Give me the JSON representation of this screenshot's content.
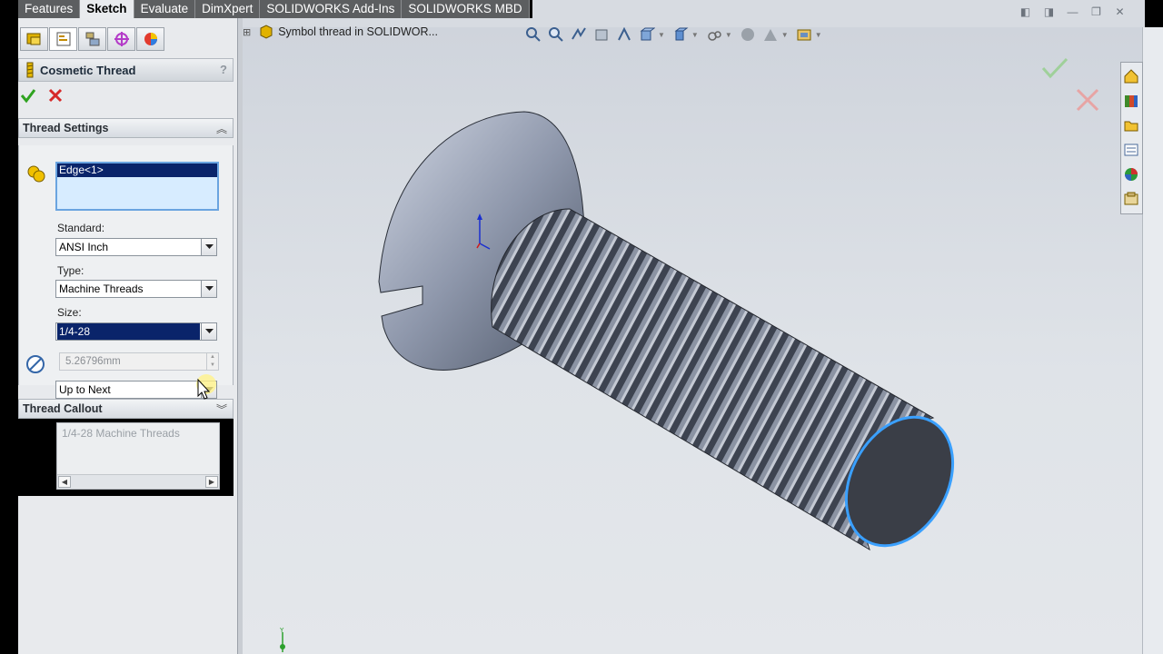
{
  "tabs": [
    "Features",
    "Sketch",
    "Evaluate",
    "DimXpert",
    "SOLIDWORKS Add-Ins",
    "SOLIDWORKS MBD"
  ],
  "active_tab": "Sketch",
  "left_panel_tabs": [
    "feature-manager-icon",
    "property-manager-icon",
    "configuration-manager-icon",
    "dimxpert-manager-icon",
    "display-manager-icon"
  ],
  "property_manager": {
    "title": "Cosmetic Thread",
    "help": "?",
    "thread_settings": {
      "header": "Thread Settings",
      "selection": "Edge<1>",
      "standard_label": "Standard:",
      "standard_value": "ANSI Inch",
      "type_label": "Type:",
      "type_value": "Machine Threads",
      "size_label": "Size:",
      "size_value": "1/4-28",
      "diameter_value": "5.26796mm",
      "end_condition": "Up to Next"
    },
    "thread_callout": {
      "header": "Thread Callout",
      "text": "1/4-28 Machine Threads"
    }
  },
  "breadcrumb": {
    "label": "Symbol thread in SOLIDWOR..."
  },
  "colors": {
    "selection": "#0a246a",
    "highlight_edge": "#3aa0ff",
    "ok": "#2fa320",
    "cancel": "#d62828"
  }
}
